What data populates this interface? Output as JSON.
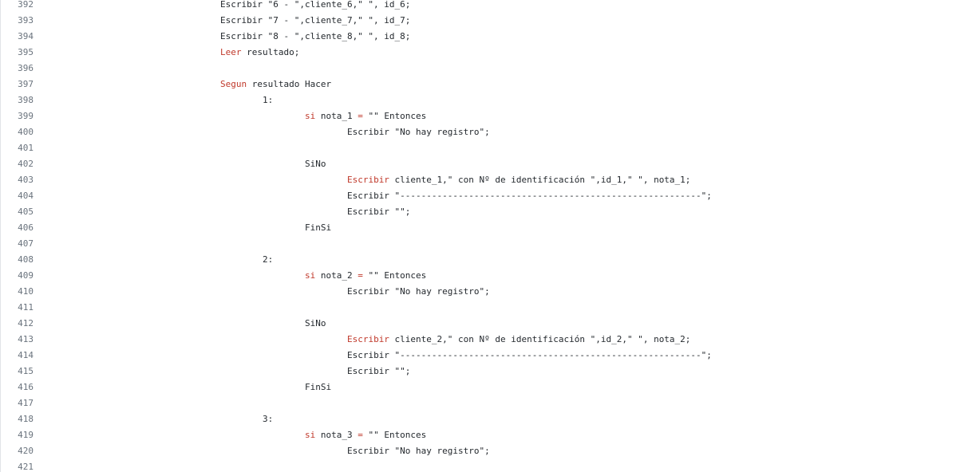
{
  "file_viewer": {
    "tab_width_spaces": 8,
    "colors": {
      "keyword": "#c0392b",
      "text": "#24292e",
      "line_number": "#6a737d",
      "background": "#ffffff"
    },
    "lines": [
      {
        "num": "392",
        "indent": 0,
        "tokens": [
          {
            "t": "Escribir \"6 - \",cliente_6,\" \", id_6;"
          }
        ]
      },
      {
        "num": "393",
        "indent": 0,
        "tokens": [
          {
            "t": "Escribir \"7 - \",cliente_7,\" \", id_7;"
          }
        ]
      },
      {
        "num": "394",
        "indent": 0,
        "tokens": [
          {
            "t": "Escribir \"8 - \",cliente_8,\" \", id_8;"
          }
        ]
      },
      {
        "num": "395",
        "indent": 0,
        "tokens": [
          {
            "t": "Leer",
            "kw": true
          },
          {
            "t": " resultado;"
          }
        ]
      },
      {
        "num": "396",
        "indent": 0,
        "tokens": []
      },
      {
        "num": "397",
        "indent": 0,
        "tokens": [
          {
            "t": "Segun",
            "kw": true
          },
          {
            "t": " resultado Hacer"
          }
        ]
      },
      {
        "num": "398",
        "indent": 1,
        "tokens": [
          {
            "t": "1:"
          }
        ]
      },
      {
        "num": "399",
        "indent": 2,
        "tokens": [
          {
            "t": "si",
            "kw": true
          },
          {
            "t": " nota_1 "
          },
          {
            "t": "=",
            "kw": true
          },
          {
            "t": " \"\" Entonces"
          }
        ]
      },
      {
        "num": "400",
        "indent": 3,
        "tokens": [
          {
            "t": "Escribir \"No hay registro\";"
          }
        ]
      },
      {
        "num": "401",
        "indent": 0,
        "tokens": []
      },
      {
        "num": "402",
        "indent": 2,
        "tokens": [
          {
            "t": "SiNo"
          }
        ]
      },
      {
        "num": "403",
        "indent": 3,
        "tokens": [
          {
            "t": "Escribir",
            "kw": true
          },
          {
            "t": " cliente_1,\" con Nº de identificación \",id_1,\" \", nota_1;"
          }
        ]
      },
      {
        "num": "404",
        "indent": 3,
        "tokens": [
          {
            "t": "Escribir \"---------------------------------------------------------\";"
          }
        ]
      },
      {
        "num": "405",
        "indent": 3,
        "tokens": [
          {
            "t": "Escribir \"\";"
          }
        ]
      },
      {
        "num": "406",
        "indent": 2,
        "tokens": [
          {
            "t": "FinSi"
          }
        ]
      },
      {
        "num": "407",
        "indent": 0,
        "tokens": []
      },
      {
        "num": "408",
        "indent": 1,
        "tokens": [
          {
            "t": "2:"
          }
        ]
      },
      {
        "num": "409",
        "indent": 2,
        "tokens": [
          {
            "t": "si",
            "kw": true
          },
          {
            "t": " nota_2 "
          },
          {
            "t": "=",
            "kw": true
          },
          {
            "t": " \"\" Entonces"
          }
        ]
      },
      {
        "num": "410",
        "indent": 3,
        "tokens": [
          {
            "t": "Escribir \"No hay registro\";"
          }
        ]
      },
      {
        "num": "411",
        "indent": 0,
        "tokens": []
      },
      {
        "num": "412",
        "indent": 2,
        "tokens": [
          {
            "t": "SiNo"
          }
        ]
      },
      {
        "num": "413",
        "indent": 3,
        "tokens": [
          {
            "t": "Escribir",
            "kw": true
          },
          {
            "t": " cliente_2,\" con Nº de identificación \",id_2,\" \", nota_2;"
          }
        ]
      },
      {
        "num": "414",
        "indent": 3,
        "tokens": [
          {
            "t": "Escribir \"---------------------------------------------------------\";"
          }
        ]
      },
      {
        "num": "415",
        "indent": 3,
        "tokens": [
          {
            "t": "Escribir \"\";"
          }
        ]
      },
      {
        "num": "416",
        "indent": 2,
        "tokens": [
          {
            "t": "FinSi"
          }
        ]
      },
      {
        "num": "417",
        "indent": 0,
        "tokens": []
      },
      {
        "num": "418",
        "indent": 1,
        "tokens": [
          {
            "t": "3:"
          }
        ]
      },
      {
        "num": "419",
        "indent": 2,
        "tokens": [
          {
            "t": "si",
            "kw": true
          },
          {
            "t": " nota_3 "
          },
          {
            "t": "=",
            "kw": true
          },
          {
            "t": " \"\" Entonces"
          }
        ]
      },
      {
        "num": "420",
        "indent": 3,
        "tokens": [
          {
            "t": "Escribir \"No hay registro\";"
          }
        ]
      },
      {
        "num": "421",
        "indent": 0,
        "tokens": []
      }
    ]
  }
}
